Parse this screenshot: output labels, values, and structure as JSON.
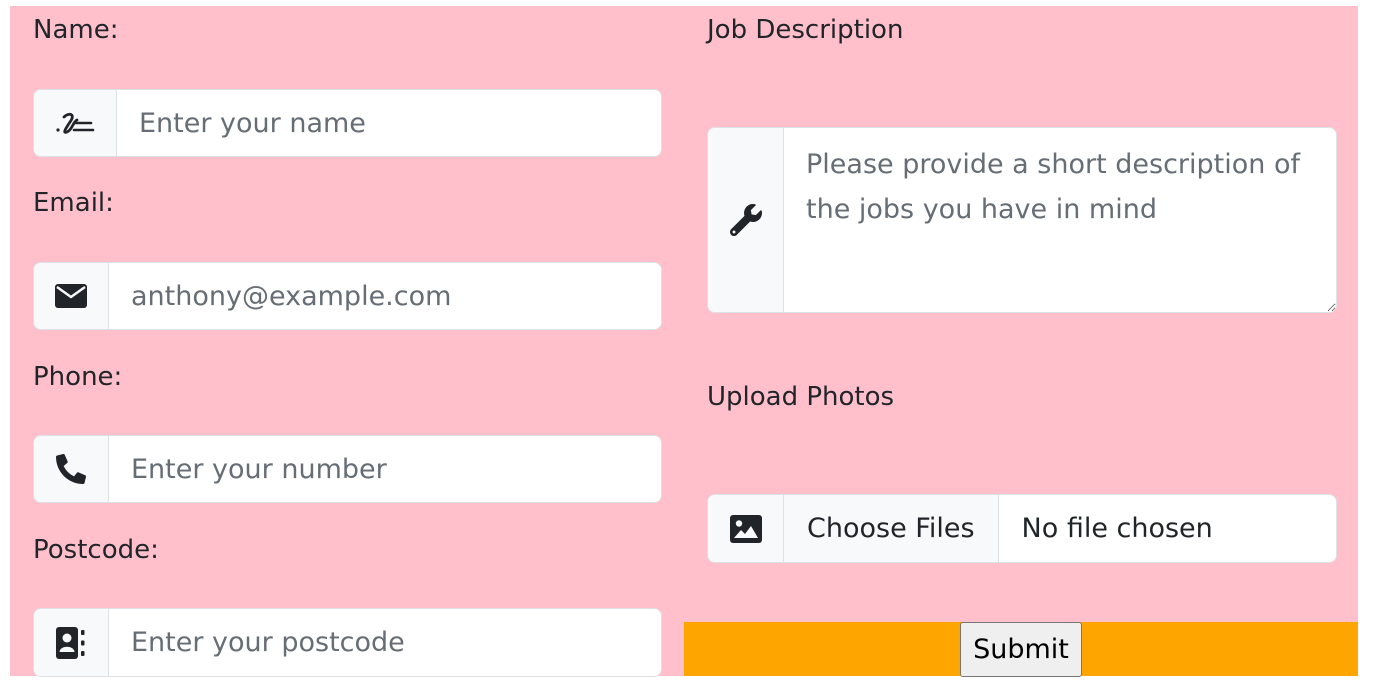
{
  "form": {
    "name": {
      "label": "Name:",
      "placeholder": "Enter your name",
      "icon": "signature-icon"
    },
    "email": {
      "label": "Email:",
      "placeholder": "anthony@example.com",
      "icon": "envelope-icon"
    },
    "phone": {
      "label": "Phone:",
      "placeholder": "Enter your number",
      "icon": "phone-icon"
    },
    "postcode": {
      "label": "Postcode:",
      "placeholder": "Enter your postcode",
      "icon": "address-book-icon"
    },
    "job_description": {
      "label": "Job Description",
      "placeholder": "Please provide a short description of the jobs you have in mind",
      "icon": "wrench-icon"
    },
    "photos": {
      "label": "Upload Photos",
      "button_label": "Choose Files",
      "status": "No file chosen",
      "icon": "image-icon"
    },
    "submit_label": "Submit"
  },
  "colors": {
    "panel_background": "#ffc0cb",
    "submit_bar": "#ffa500",
    "addon_background": "#f8f9fa",
    "border": "#dee2e6"
  }
}
